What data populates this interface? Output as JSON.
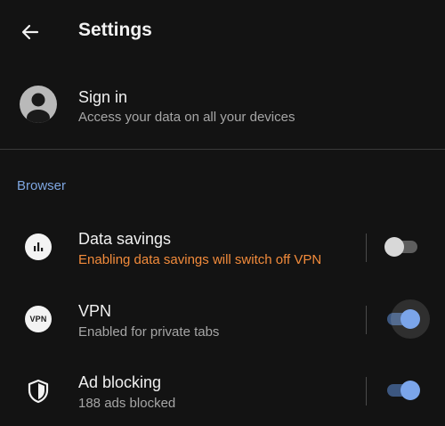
{
  "header": {
    "title": "Settings",
    "back_icon": "arrow-left-icon"
  },
  "account": {
    "title": "Sign in",
    "subtitle": "Access your data on all your devices",
    "icon": "account-circle-icon"
  },
  "section": {
    "label": "Browser"
  },
  "settings": [
    {
      "title": "Data savings",
      "subtitle": "Enabling data savings will switch off VPN",
      "subtitle_color": "#f28b3b",
      "icon": "bar-chart-icon",
      "enabled": false
    },
    {
      "title": "VPN",
      "subtitle": "Enabled for private tabs",
      "icon": "vpn-icon",
      "icon_text": "VPN",
      "enabled": true
    },
    {
      "title": "Ad blocking",
      "subtitle": "188 ads blocked",
      "icon": "shield-icon",
      "enabled": true
    }
  ],
  "colors": {
    "background": "#131313",
    "accent": "#7ba5ea",
    "section_label": "#7ea6e0",
    "warning": "#f28b3b"
  }
}
